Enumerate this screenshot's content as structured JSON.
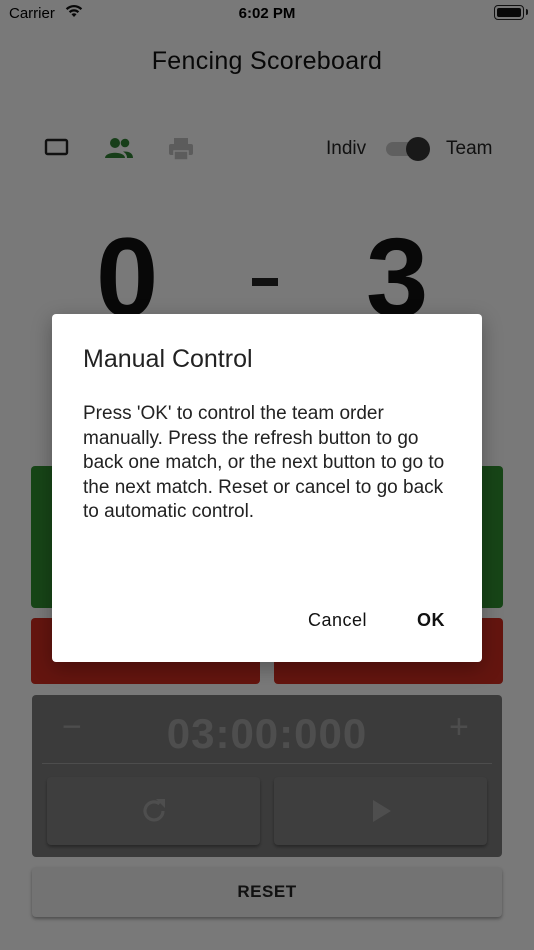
{
  "status_bar": {
    "carrier": "Carrier",
    "time": "6:02 PM"
  },
  "app": {
    "title": "Fencing Scoreboard"
  },
  "toolbar": {
    "icons": [
      "single-screen-icon",
      "team-icon",
      "print-icon"
    ],
    "mode_left": "Indiv",
    "mode_right": "Team",
    "mode_is_team": true
  },
  "score": {
    "left": "0",
    "right": "3"
  },
  "timer": {
    "minus": "−",
    "value": "03:00:000",
    "plus": "+"
  },
  "reset_label": "RESET",
  "dialog": {
    "title": "Manual Control",
    "body": "Press 'OK' to control the team order manually. Press the refresh button to go back one match, or the next button to go to the next match. Reset or cancel to go back to automatic control.",
    "cancel_label": "Cancel",
    "ok_label": "OK"
  },
  "colors": {
    "green": "#2e8b2e",
    "red": "#c82a1e",
    "accent_green_icon": "#2e7d32"
  }
}
